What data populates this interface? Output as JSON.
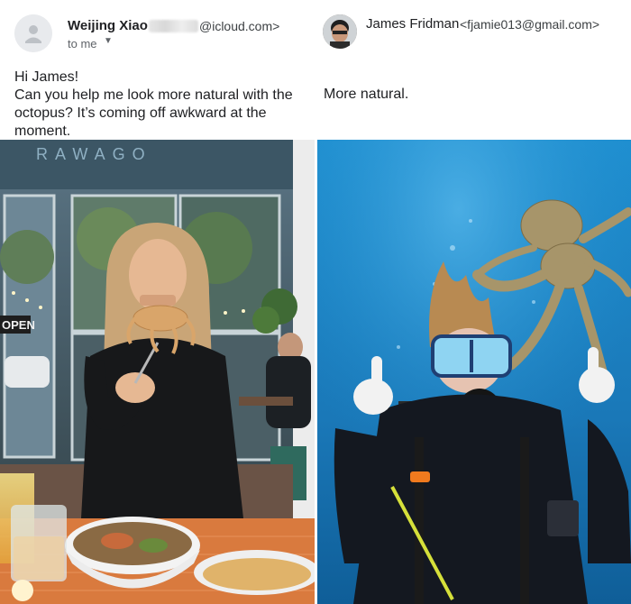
{
  "left_email": {
    "sender_name": "Weijing Xiao",
    "sender_addr_domain": "@icloud.com>",
    "recipient_label": "to me",
    "greeting": "Hi James!",
    "body_line1": "Can you help me look more natural with the",
    "body_line2": "octopus? It’s coming off awkward at the",
    "body_line3": "moment.",
    "sign_text": "OPEN",
    "window_text": "RAWAGO",
    "icons": [
      "person-avatar-icon",
      "chevron-down-icon"
    ]
  },
  "right_email": {
    "sender_name": "James Fridman",
    "sender_addr": "<fjamie013@gmail.com>",
    "body": "More natural."
  },
  "colors": {
    "ocean": "#1e88c6",
    "ocean_deep": "#0f5e98",
    "restaurant_dark": "#2a3438",
    "skin": "#e6b893",
    "hair": "#c9a577",
    "text": "#202124",
    "muted": "#5f6368"
  }
}
